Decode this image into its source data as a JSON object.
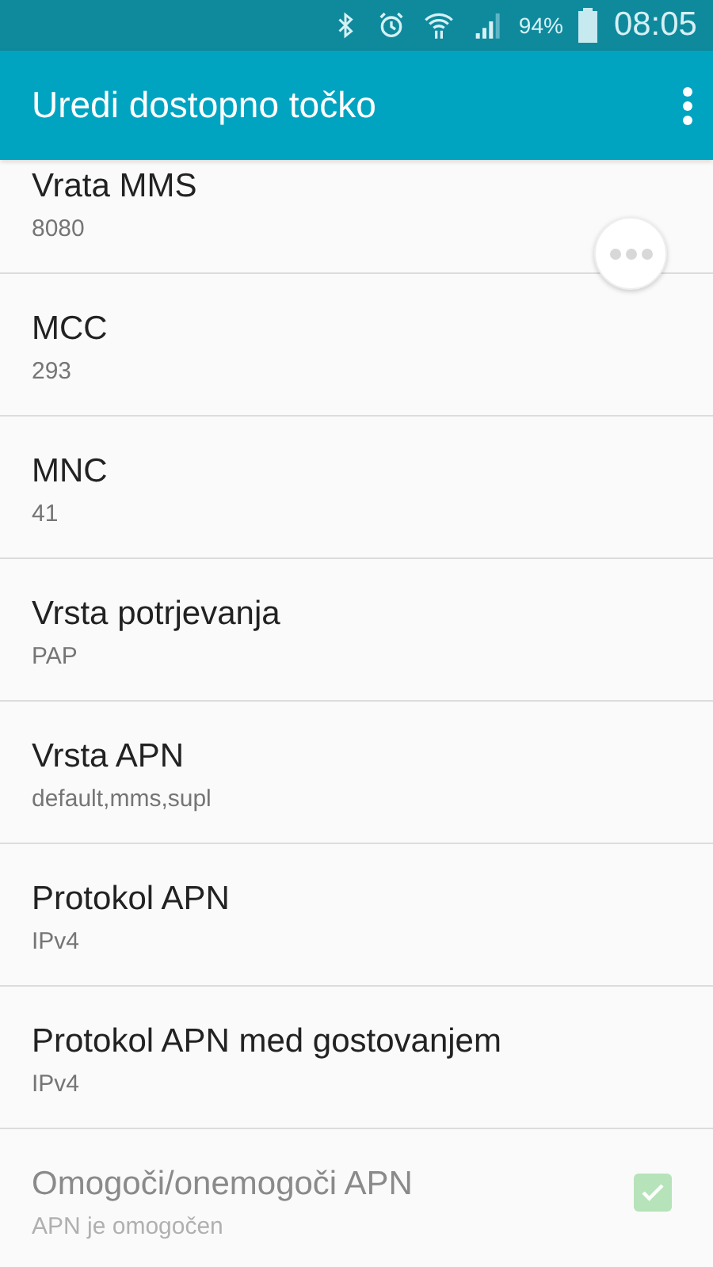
{
  "status_bar": {
    "battery": "94%",
    "time": "08:05"
  },
  "app_bar": {
    "title": "Uredi dostopno točko"
  },
  "settings": [
    {
      "kind": "text",
      "title": "Vrata MMS",
      "value": "8080"
    },
    {
      "kind": "text",
      "title": "MCC",
      "value": "293"
    },
    {
      "kind": "text",
      "title": "MNC",
      "value": "41"
    },
    {
      "kind": "text",
      "title": "Vrsta potrjevanja",
      "value": "PAP"
    },
    {
      "kind": "text",
      "title": "Vrsta APN",
      "value": "default,mms,supl"
    },
    {
      "kind": "text",
      "title": "Protokol APN",
      "value": "IPv4"
    },
    {
      "kind": "text",
      "title": "Protokol APN med gostovanjem",
      "value": "IPv4"
    },
    {
      "kind": "checkbox",
      "title": "Omogoči/onemogoči APN",
      "value": "APN je omogočen",
      "checked": true,
      "disabled": true
    }
  ]
}
